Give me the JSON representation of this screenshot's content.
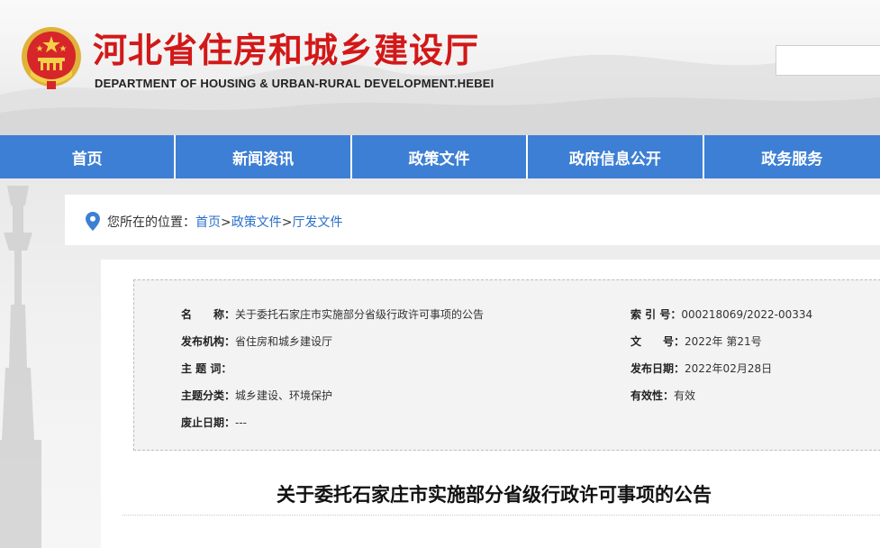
{
  "header": {
    "title": "河北省住房和城乡建设厅",
    "subtitle": "DEPARTMENT OF HOUSING & URBAN-RURAL DEVELOPMENT.HEBEI",
    "emblem_icon": "national-emblem-icon",
    "title_color": "#d21818"
  },
  "search": {
    "placeholder": ""
  },
  "nav": {
    "color": "#3d7fd4",
    "items": [
      "首页",
      "新闻资讯",
      "政策文件",
      "政府信息公开",
      "政务服务"
    ]
  },
  "breadcrumb": {
    "icon": "location-pin-icon",
    "prefix": "您所在的位置：",
    "links": [
      "首页",
      "政策文件",
      "厅发文件"
    ],
    "separator": ">"
  },
  "meta": {
    "name_label": "名　　称：",
    "name_value": "关于委托石家庄市实施部分省级行政许可事项的公告",
    "index_label": "索 引 号：",
    "index_value": "000218069/2022-00334",
    "publisher_label": "发布机构：",
    "publisher_value": "省住房和城乡建设厅",
    "doc_no_label": "文　　号：",
    "doc_no_value": "2022年 第21号",
    "keywords_label": "主 题 词：",
    "keywords_value": "",
    "date_label": "发布日期：",
    "date_value": "2022年02月28日",
    "category_label": "主题分类：",
    "category_value": "城乡建设、环境保护",
    "validity_label": "有效性：",
    "validity_value": "有效",
    "expire_label": "废止日期：",
    "expire_value": "---"
  },
  "document": {
    "title": "关于委托石家庄市实施部分省级行政许可事项的公告"
  }
}
